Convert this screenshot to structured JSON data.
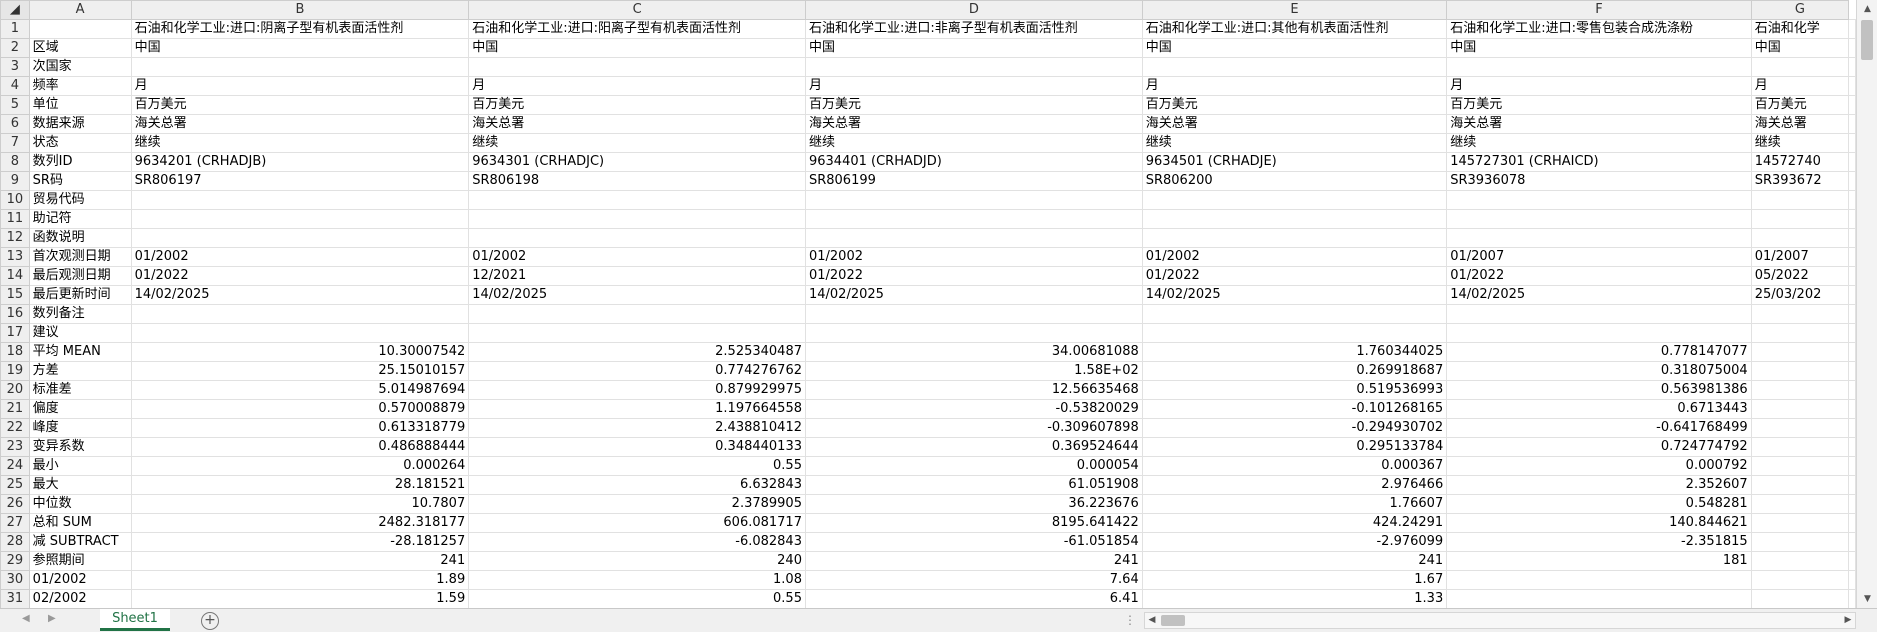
{
  "columns": [
    {
      "letter": "A"
    },
    {
      "letter": "B"
    },
    {
      "letter": "C"
    },
    {
      "letter": "D"
    },
    {
      "letter": "E"
    },
    {
      "letter": "F"
    },
    {
      "letter": "G"
    }
  ],
  "rows": [
    {
      "n": "1",
      "cells": [
        "",
        "石油和化学工业:进口:阴离子型有机表面活性剂",
        "石油和化学工业:进口:阳离子型有机表面活性剂",
        "石油和化学工业:进口:非离子型有机表面活性剂",
        "石油和化学工业:进口:其他有机表面活性剂",
        "石油和化学工业:进口:零售包装合成洗涤粉",
        "石油和化学"
      ]
    },
    {
      "n": "2",
      "cells": [
        "区域",
        "中国",
        "中国",
        "中国",
        "中国",
        "中国",
        "中国"
      ]
    },
    {
      "n": "3",
      "cells": [
        "次国家",
        "",
        "",
        "",
        "",
        "",
        ""
      ]
    },
    {
      "n": "4",
      "cells": [
        "频率",
        "月",
        "月",
        "月",
        "月",
        "月",
        "月"
      ]
    },
    {
      "n": "5",
      "cells": [
        "单位",
        "百万美元",
        "百万美元",
        "百万美元",
        "百万美元",
        "百万美元",
        "百万美元"
      ]
    },
    {
      "n": "6",
      "cells": [
        "数据来源",
        "海关总署",
        "海关总署",
        "海关总署",
        "海关总署",
        "海关总署",
        "海关总署"
      ]
    },
    {
      "n": "7",
      "cells": [
        "状态",
        "继续",
        "继续",
        "继续",
        "继续",
        "继续",
        "继续"
      ]
    },
    {
      "n": "8",
      "cells": [
        "数列ID",
        "9634201 (CRHADJB)",
        "9634301 (CRHADJC)",
        "9634401 (CRHADJD)",
        "9634501 (CRHADJE)",
        "145727301 (CRHAICD)",
        "14572740"
      ]
    },
    {
      "n": "9",
      "cells": [
        "SR码",
        "SR806197",
        "SR806198",
        "SR806199",
        "SR806200",
        "SR3936078",
        "SR393672"
      ]
    },
    {
      "n": "10",
      "cells": [
        "贸易代码",
        "",
        "",
        "",
        "",
        "",
        ""
      ]
    },
    {
      "n": "11",
      "cells": [
        "助记符",
        "",
        "",
        "",
        "",
        "",
        ""
      ]
    },
    {
      "n": "12",
      "cells": [
        "函数说明",
        "",
        "",
        "",
        "",
        "",
        ""
      ]
    },
    {
      "n": "13",
      "cells": [
        "首次观测日期",
        "01/2002",
        "01/2002",
        "01/2002",
        "01/2002",
        "01/2007",
        "01/2007"
      ]
    },
    {
      "n": "14",
      "cells": [
        "最后观测日期",
        "01/2022",
        "12/2021",
        "01/2022",
        "01/2022",
        "01/2022",
        "05/2022"
      ]
    },
    {
      "n": "15",
      "cells": [
        "最后更新时间",
        "14/02/2025",
        "14/02/2025",
        "14/02/2025",
        "14/02/2025",
        "14/02/2025",
        "25/03/202"
      ]
    },
    {
      "n": "16",
      "cells": [
        "数列备注",
        "",
        "",
        "",
        "",
        "",
        ""
      ]
    },
    {
      "n": "17",
      "cells": [
        "建议",
        "",
        "",
        "",
        "",
        "",
        ""
      ]
    },
    {
      "n": "18",
      "cells": [
        "平均 MEAN",
        "10.30007542",
        "2.525340487",
        "34.00681088",
        "1.760344025",
        "0.778147077",
        ""
      ]
    },
    {
      "n": "19",
      "cells": [
        "方差",
        "25.15010157",
        "0.774276762",
        "1.58E+02",
        "0.269918687",
        "0.318075004",
        ""
      ]
    },
    {
      "n": "20",
      "cells": [
        "标准差",
        "5.014987694",
        "0.879929975",
        "12.56635468",
        "0.519536993",
        "0.563981386",
        ""
      ]
    },
    {
      "n": "21",
      "cells": [
        "偏度",
        "0.570008879",
        "1.197664558",
        "-0.53820029",
        "-0.101268165",
        "0.6713443",
        ""
      ]
    },
    {
      "n": "22",
      "cells": [
        "峰度",
        "0.613318779",
        "2.438810412",
        "-0.309607898",
        "-0.294930702",
        "-0.641768499",
        ""
      ]
    },
    {
      "n": "23",
      "cells": [
        "变异系数",
        "0.486888444",
        "0.348440133",
        "0.369524644",
        "0.295133784",
        "0.724774792",
        ""
      ]
    },
    {
      "n": "24",
      "cells": [
        "最小",
        "0.000264",
        "0.55",
        "0.000054",
        "0.000367",
        "0.000792",
        ""
      ]
    },
    {
      "n": "25",
      "cells": [
        "最大",
        "28.181521",
        "6.632843",
        "61.051908",
        "2.976466",
        "2.352607",
        ""
      ]
    },
    {
      "n": "26",
      "cells": [
        "中位数",
        "10.7807",
        "2.3789905",
        "36.223676",
        "1.76607",
        "0.548281",
        ""
      ]
    },
    {
      "n": "27",
      "cells": [
        "总和 SUM",
        "2482.318177",
        "606.081717",
        "8195.641422",
        "424.24291",
        "140.844621",
        ""
      ]
    },
    {
      "n": "28",
      "cells": [
        "减 SUBTRACT",
        "-28.181257",
        "-6.082843",
        "-61.051854",
        "-2.976099",
        "-2.351815",
        ""
      ]
    },
    {
      "n": "29",
      "cells": [
        "参照期间",
        "241",
        "240",
        "241",
        "241",
        "181",
        ""
      ]
    },
    {
      "n": "30",
      "cells": [
        "01/2002",
        "1.89",
        "1.08",
        "7.64",
        "1.67",
        "",
        ""
      ]
    },
    {
      "n": "31",
      "cells": [
        "02/2002",
        "1.59",
        "0.55",
        "6.41",
        "1.33",
        "",
        ""
      ]
    }
  ],
  "sheet_tabs": [
    {
      "label": "Sheet1",
      "active": true
    }
  ],
  "add_sheet_symbol": "+",
  "accent_color": "#217346"
}
